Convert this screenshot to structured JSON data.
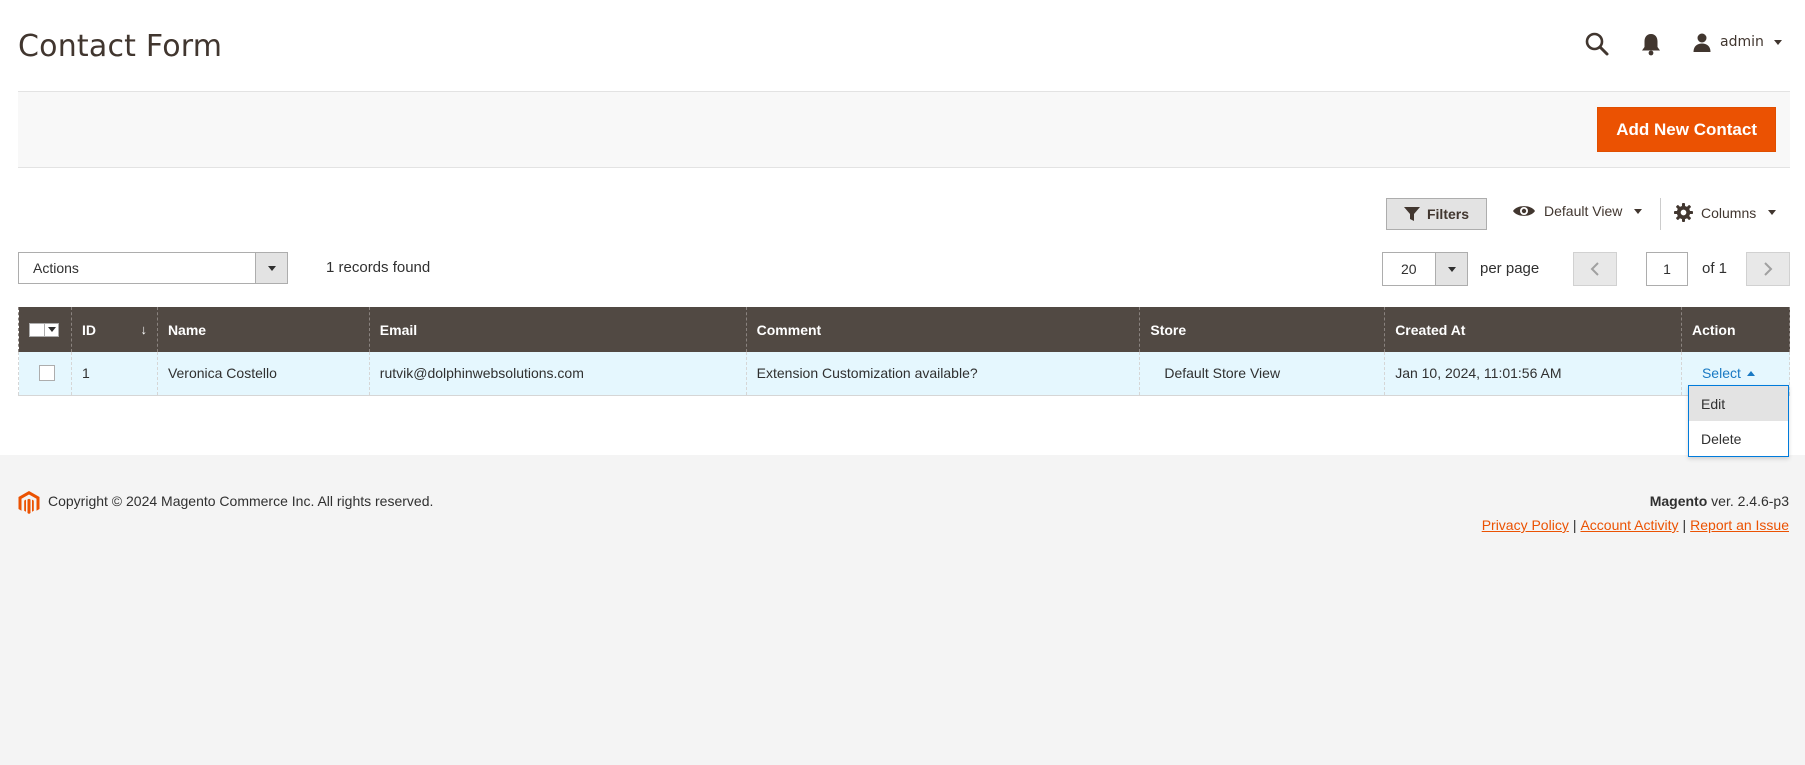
{
  "header": {
    "title": "Contact Form",
    "user": "admin"
  },
  "action_band": {
    "add_button": "Add New Contact"
  },
  "toolbar": {
    "filters": "Filters",
    "view": "Default View",
    "columns": "Columns",
    "actions": "Actions",
    "records": "1 records found",
    "per_page_value": "20",
    "per_page_label": "per page",
    "page": "1",
    "of_pages": "of 1"
  },
  "table": {
    "headers": [
      "ID",
      "Name",
      "Email",
      "Comment",
      "Store",
      "Created At",
      "Action"
    ],
    "rows": [
      {
        "id": "1",
        "name": "Veronica Costello",
        "email": "rutvik@dolphinwebsolutions.com",
        "comment": "Extension Customization available?",
        "store": "Default Store View",
        "created_at": "Jan 10, 2024, 11:01:56 AM",
        "action": "Select"
      }
    ]
  },
  "action_menu": {
    "items": [
      "Edit",
      "Delete"
    ]
  },
  "footer": {
    "copyright": "Copyright © 2024 Magento Commerce Inc. All rights reserved.",
    "product": "Magento",
    "version": " ver. 2.4.6-p3",
    "links": [
      "Privacy Policy",
      "Account Activity",
      "Report an Issue"
    ]
  },
  "colors": {
    "accent": "#eb5202",
    "header_bg": "#514943",
    "row_bg": "#e5f7fe",
    "link": "#1979c3"
  },
  "icons": [
    "search-icon",
    "bell-icon",
    "user-icon",
    "filter-icon",
    "eye-icon",
    "gear-icon",
    "magento-logo-icon"
  ]
}
